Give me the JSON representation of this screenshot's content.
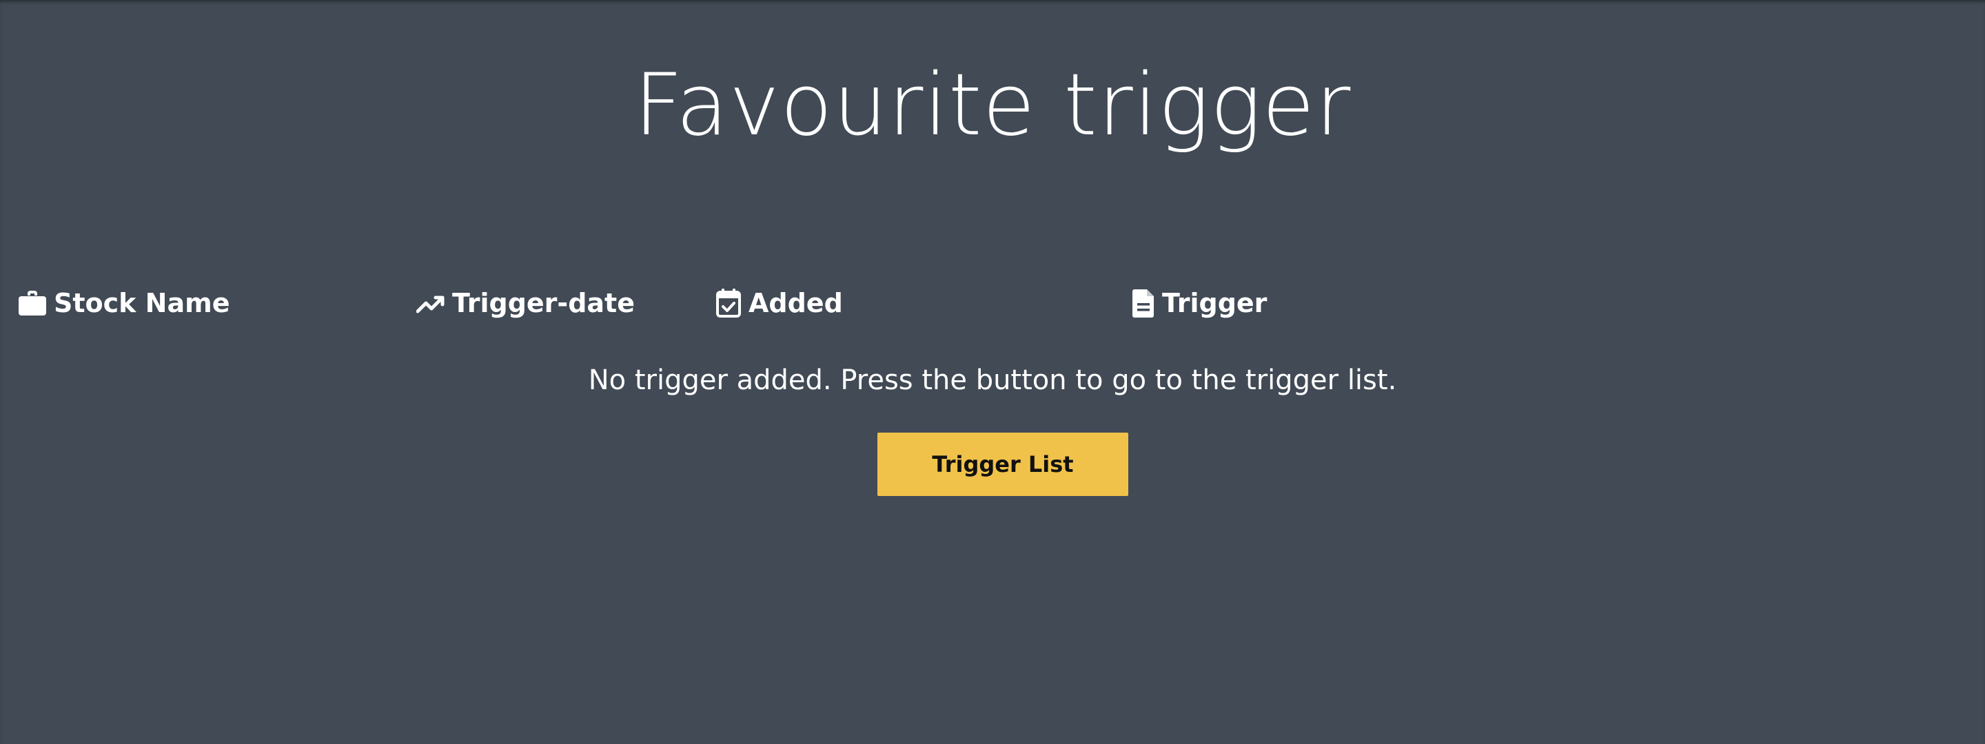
{
  "page": {
    "title": "Favourite trigger"
  },
  "table": {
    "columns": [
      {
        "label": "Stock Name",
        "icon": "briefcase-icon"
      },
      {
        "label": "Trigger-date",
        "icon": "trending-up-icon"
      },
      {
        "label": "Added",
        "icon": "calendar-check-icon"
      },
      {
        "label": "Trigger",
        "icon": "document-icon"
      }
    ],
    "empty_message": "No trigger added. Press the button to go to the trigger list."
  },
  "actions": {
    "trigger_list_label": "Trigger List"
  },
  "colors": {
    "background": "#414a55",
    "accent_button": "#f1c24a",
    "text": "#ffffff",
    "button_text": "#111111"
  }
}
